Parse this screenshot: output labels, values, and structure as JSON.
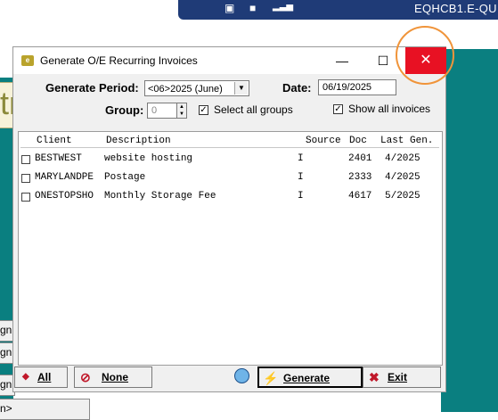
{
  "taskbar": {
    "title": "EQHCB1.E-QU"
  },
  "background": {
    "stub_text": "gn",
    "bottom_text": "n>"
  },
  "dialog": {
    "title": "Generate O/E Recurring Invoices",
    "generate_period_label": "Generate Period:",
    "generate_period_value": "<06>2025 (June)",
    "date_label": "Date:",
    "date_value": "06/19/2025",
    "group_label": "Group:",
    "group_value": "0",
    "select_all_groups_label": "Select all groups",
    "select_all_groups_checked": true,
    "show_all_invoices_label": "Show all invoices",
    "show_all_invoices_checked": true,
    "columns": [
      "Client",
      "Description",
      "Source",
      "Doc",
      "Last Gen."
    ],
    "rows": [
      {
        "client": "BESTWEST",
        "description": "website hosting",
        "source": "I",
        "doc": "2401",
        "last_gen": "4/2025"
      },
      {
        "client": "MARYLANDPE",
        "description": "Postage",
        "source": "I",
        "doc": "2333",
        "last_gen": "4/2025"
      },
      {
        "client": "ONESTOPSHO",
        "description": "Monthly Storage Fee",
        "source": "I",
        "doc": "4617",
        "last_gen": "5/2025"
      }
    ],
    "buttons": {
      "all": "All",
      "none": "None",
      "generate": "Generate",
      "exit": "Exit"
    }
  }
}
